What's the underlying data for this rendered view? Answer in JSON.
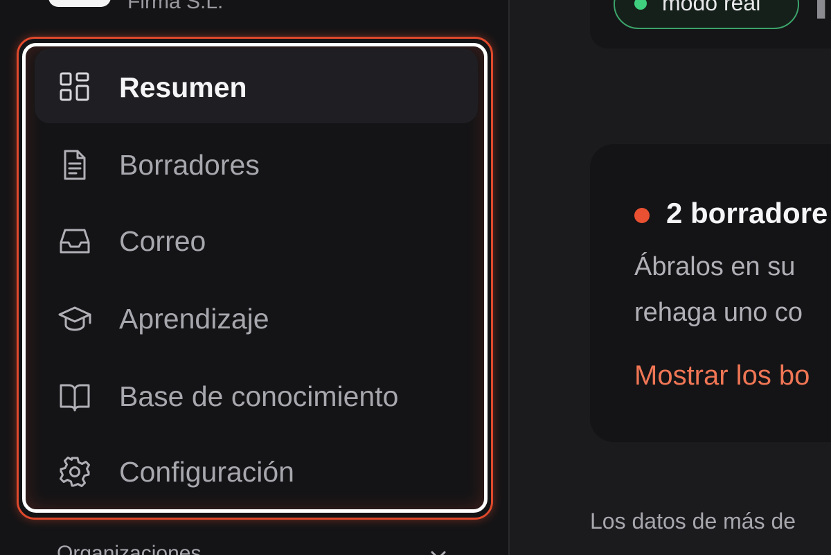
{
  "sidebar": {
    "org_name": "Firma S.L.",
    "nav": [
      {
        "label": "Resumen",
        "icon": "dashboard-grid-icon",
        "active": true
      },
      {
        "label": "Borradores",
        "icon": "document-icon",
        "active": false
      },
      {
        "label": "Correo",
        "icon": "inbox-icon",
        "active": false
      },
      {
        "label": "Aprendizaje",
        "icon": "graduation-cap-icon",
        "active": false
      },
      {
        "label": "Base de conocimiento",
        "icon": "open-book-icon",
        "active": false
      },
      {
        "label": "Configuración",
        "icon": "gear-icon",
        "active": false
      }
    ],
    "organizations_label": "Organizaciones",
    "organizations_icon": "chevron-down-icon"
  },
  "header": {
    "mode_label": "modo real",
    "mode_color": "#3fcf7e"
  },
  "alert_card": {
    "title": "2 borradore",
    "line_1": "Ábralos en su",
    "line_2": "rehaga uno co",
    "link": "Mostrar los bo",
    "dot_color": "#ea5133"
  },
  "footer": {
    "note": "Los datos de más de"
  },
  "colors": {
    "accent": "#e0492c",
    "link": "#f07655",
    "success": "#3fcf7e",
    "background": "#1b1b1e",
    "sidebar": "#141416"
  }
}
